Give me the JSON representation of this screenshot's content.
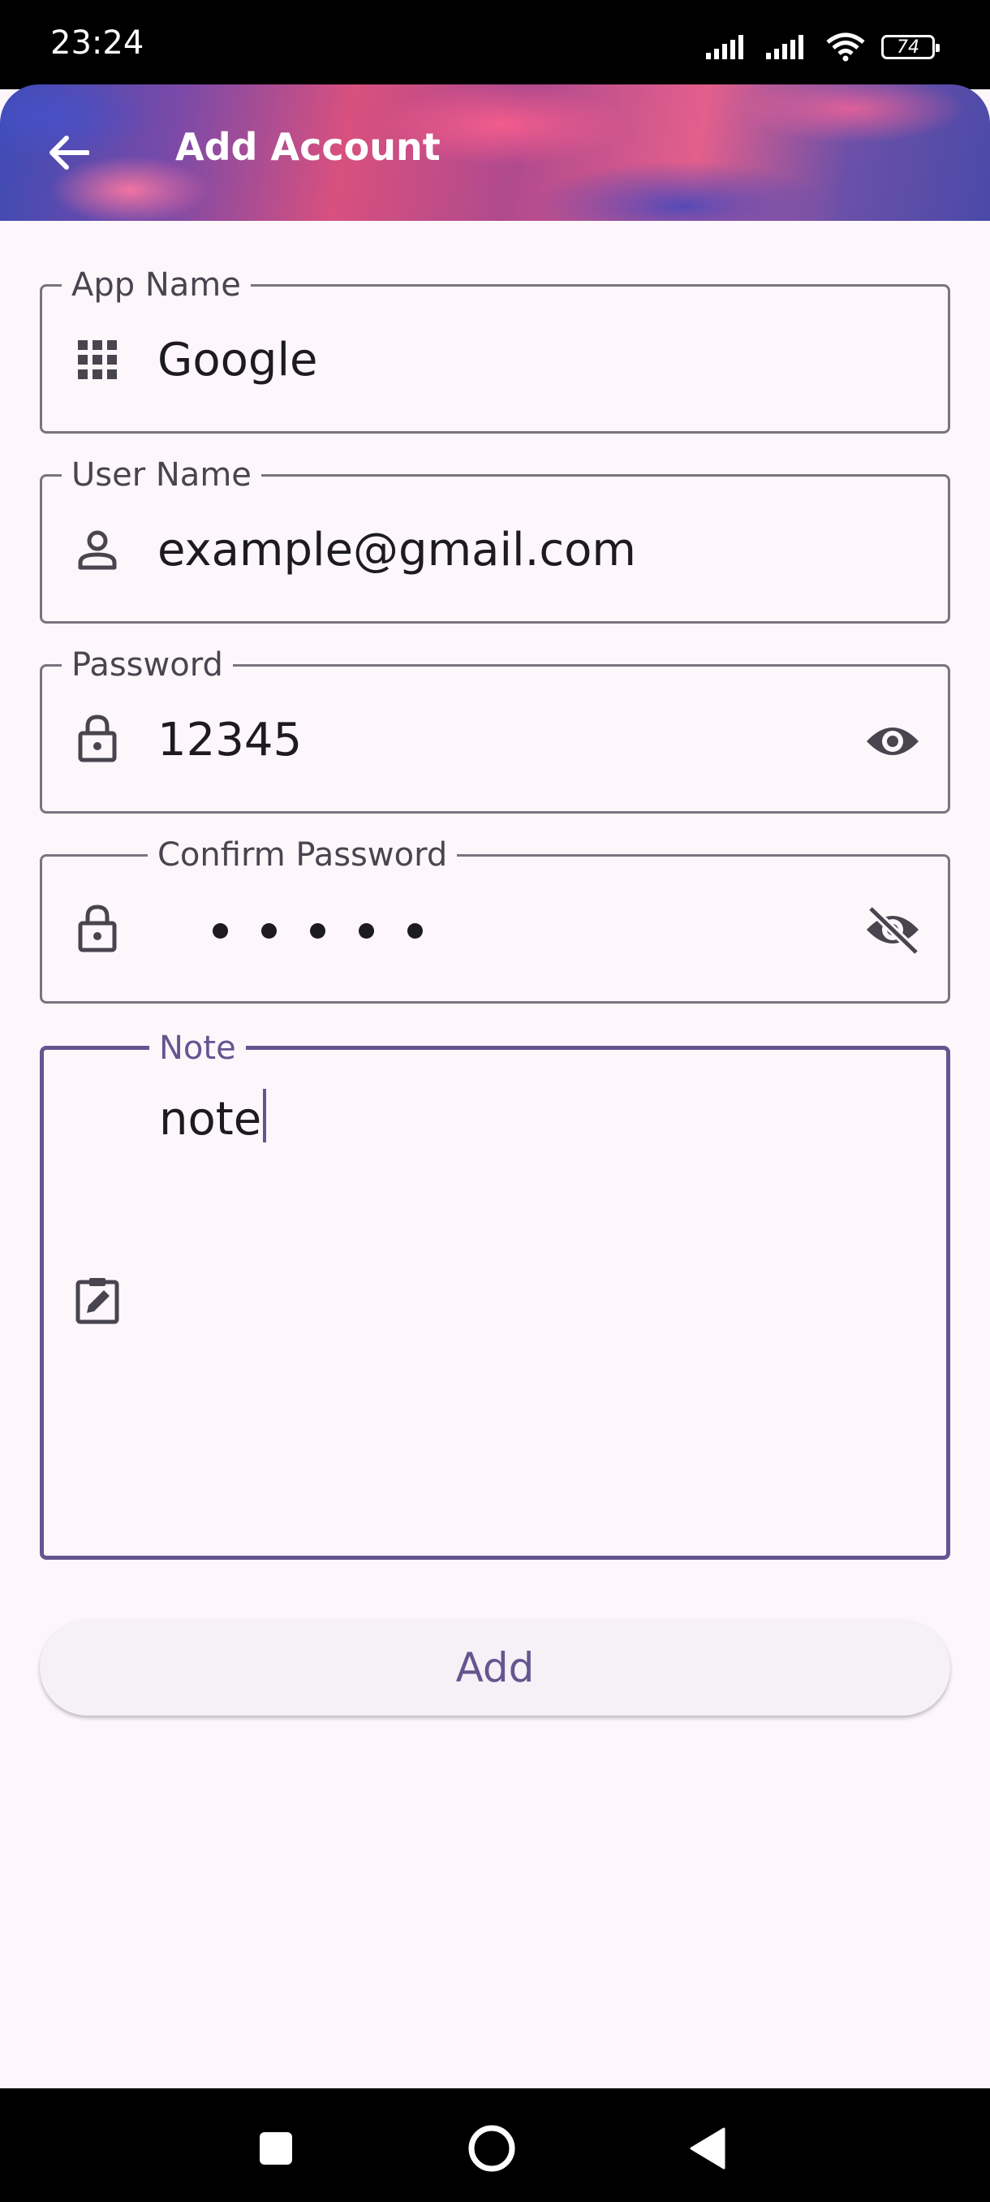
{
  "status_bar": {
    "time": "23:24",
    "battery": "74"
  },
  "app_bar": {
    "title": "Add Account"
  },
  "form": {
    "app_name": {
      "label": "App Name",
      "value": "Google"
    },
    "user_name": {
      "label": "User Name",
      "value": "example@gmail.com"
    },
    "password": {
      "label": "Password",
      "value": "12345"
    },
    "confirm_password": {
      "label": "Confirm Password",
      "masked_length": 5
    },
    "note": {
      "label": "Note",
      "value": "note"
    }
  },
  "actions": {
    "add_label": "Add"
  },
  "colors": {
    "accent": "#65558f",
    "background": "#fdf7fc",
    "outline": "#79747e"
  },
  "icons": [
    "arrow-back-icon",
    "apps-grid-icon",
    "person-icon",
    "lock-icon",
    "visibility-icon",
    "visibility-off-icon",
    "edit-note-icon",
    "nav-square-icon",
    "nav-home-icon",
    "nav-back-icon"
  ]
}
